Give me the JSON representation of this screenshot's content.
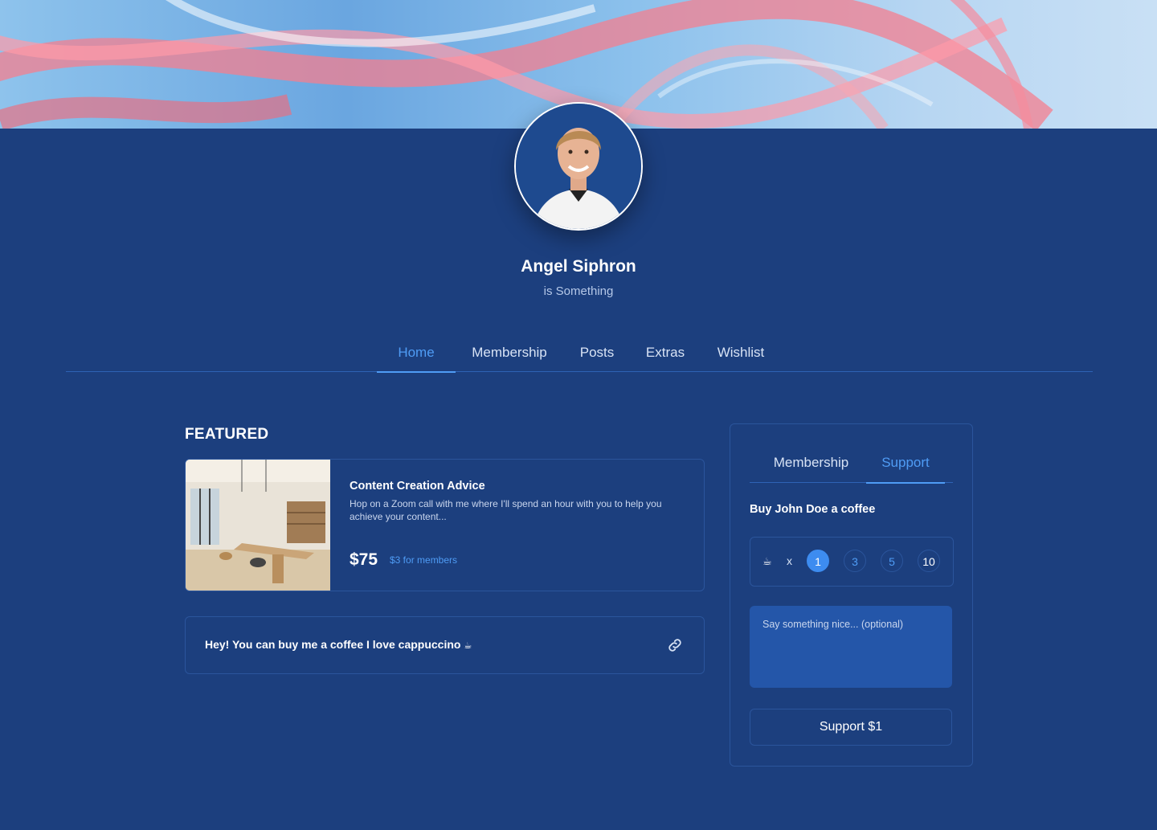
{
  "profile": {
    "name": "Angel Siphron",
    "tagline": "is Something"
  },
  "main_tabs": [
    {
      "label": "Home",
      "active": true
    },
    {
      "label": "Membership",
      "active": false
    },
    {
      "label": "Posts",
      "active": false
    },
    {
      "label": "Extras",
      "active": false
    },
    {
      "label": "Wishlist",
      "active": false
    }
  ],
  "featured": {
    "heading": "FEATURED",
    "card": {
      "title": "Content Creation Advice",
      "description": "Hop on a Zoom call with me where I'll spend an hour with you to help you achieve your content...",
      "price": "$75",
      "member_price": "$3 for members"
    },
    "link_card": {
      "text": "Hey! You can buy me a coffee I love cappuccino",
      "icon": "link-icon"
    }
  },
  "support_panel": {
    "tabs": [
      {
        "label": "Membership",
        "active": false
      },
      {
        "label": "Support",
        "active": true
      }
    ],
    "heading": "Buy John Doe a coffee",
    "cup_icon": "coffee-cup-icon",
    "times": "x",
    "quantities": [
      "1",
      "3",
      "5",
      "10"
    ],
    "selected_quantity": "1",
    "message_placeholder": "Say something nice... (optional)",
    "button_label": "Support $1"
  },
  "colors": {
    "background": "#1c3f7e",
    "accent": "#4f9cf5",
    "border": "#2b559c",
    "input_bg": "#2456a9"
  }
}
